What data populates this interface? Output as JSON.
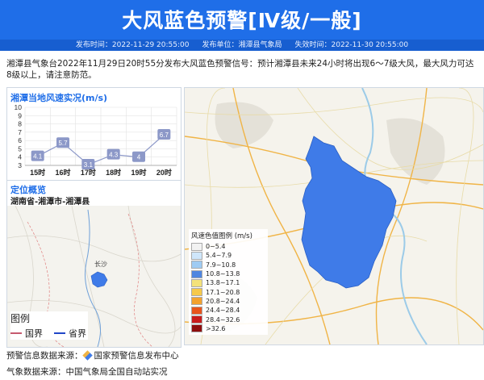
{
  "header": {
    "title": "大风蓝色预警[Ⅳ级/一般]",
    "issue_time": "发布时间：2022-11-29 20:55:00",
    "issuer": "发布单位：湘潭县气象局",
    "expire_time": "失效时间：2022-11-30 20:55:00"
  },
  "description": "湘潭县气象台2022年11月29日20时55分发布大风蓝色预警信号：预计湘潭县未来24小时将出现6～7级大风，最大风力可达8级以上，请注意防范。",
  "wind_panel": {
    "title": "湘潭当地风速实况(m/s)"
  },
  "chart_data": {
    "type": "line",
    "categories": [
      "15时",
      "16时",
      "17时",
      "18时",
      "19时",
      "20时"
    ],
    "values": [
      4.1,
      5.7,
      3.1,
      4.3,
      4,
      6.7
    ],
    "title": "湘潭当地风速实况(m/s)",
    "yticks": [
      3,
      4,
      5,
      6,
      7,
      8,
      9,
      10
    ],
    "ylim": [
      3,
      10
    ],
    "grid": true,
    "color": "#8c98c8"
  },
  "location_panel": {
    "title": "定位概览",
    "subtitle": "湖南省-湘潭市-湘潭县",
    "city_label": "长沙",
    "legend_title": "图例",
    "legend_items": [
      {
        "label": "国界",
        "color": "#c65a6e"
      },
      {
        "label": "省界",
        "color": "#2046c8"
      }
    ]
  },
  "map_legend": {
    "title": "风速色值图例 (m/s)",
    "items": [
      {
        "label": "0~5.4",
        "color": "#f2f2f2"
      },
      {
        "label": "5.4~7.9",
        "color": "#cfe6fb"
      },
      {
        "label": "7.9~10.8",
        "color": "#9fcbf3"
      },
      {
        "label": "10.8~13.8",
        "color": "#4f86e0"
      },
      {
        "label": "13.8~17.1",
        "color": "#f4e27a"
      },
      {
        "label": "17.1~20.8",
        "color": "#f6c94a"
      },
      {
        "label": "20.8~24.4",
        "color": "#f3a22f"
      },
      {
        "label": "24.4~28.4",
        "color": "#e8551c"
      },
      {
        "label": "28.4~32.6",
        "color": "#c91c1c"
      },
      {
        "label": ">32.6",
        "color": "#8e0e0e"
      }
    ]
  },
  "footer": {
    "warning_source": "预警信息数据来源：",
    "warning_source_name": "国家预警信息发布中心",
    "weather_source": "气象数据来源：中国气象局全国自动站实况"
  },
  "colors": {
    "brand": "#1f6ee8",
    "region_fill": "#3f7be8"
  }
}
